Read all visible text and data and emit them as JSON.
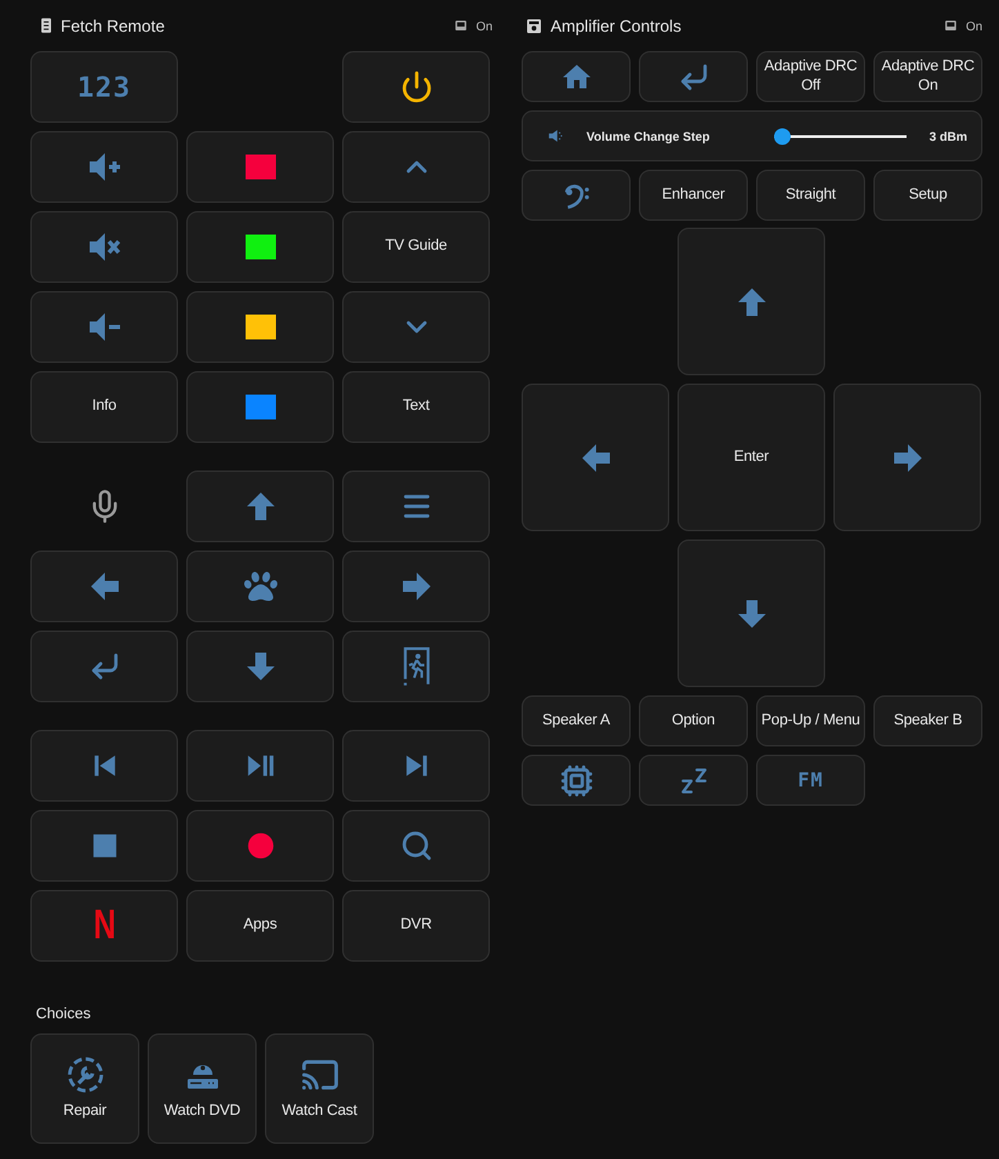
{
  "remote": {
    "title": "Fetch Remote",
    "status": "On",
    "sections": [
      {
        "buttons": [
          {
            "kind": "digital",
            "label": "123"
          },
          {
            "kind": "empty"
          },
          {
            "kind": "icon"
          },
          {
            "kind": "icon"
          },
          {
            "kind": "swatch",
            "color": "#f5003d"
          },
          {
            "kind": "icon"
          },
          {
            "kind": "icon"
          },
          {
            "kind": "swatch",
            "color": "#10f010"
          },
          {
            "kind": "label",
            "label": "TV Guide"
          },
          {
            "kind": "icon"
          },
          {
            "kind": "swatch",
            "color": "#ffc107"
          },
          {
            "kind": "icon"
          },
          {
            "kind": "label",
            "label": "Info"
          },
          {
            "kind": "swatch",
            "color": "#0a84ff"
          },
          {
            "kind": "label",
            "label": "Text"
          }
        ]
      },
      {
        "buttons": [
          {
            "kind": "bare-icon"
          },
          {
            "kind": "icon"
          },
          {
            "kind": "icon"
          },
          {
            "kind": "icon"
          },
          {
            "kind": "icon"
          },
          {
            "kind": "icon"
          },
          {
            "kind": "icon"
          },
          {
            "kind": "icon"
          },
          {
            "kind": "icon"
          }
        ]
      },
      {
        "buttons": [
          {
            "kind": "icon"
          },
          {
            "kind": "icon"
          },
          {
            "kind": "icon"
          },
          {
            "kind": "icon"
          },
          {
            "kind": "icon"
          },
          {
            "kind": "icon"
          },
          {
            "kind": "logo",
            "label": "N"
          },
          {
            "kind": "label",
            "label": "Apps"
          },
          {
            "kind": "label",
            "label": "DVR"
          }
        ]
      }
    ]
  },
  "choices": {
    "title": "Choices",
    "buttons": [
      {
        "label": "Repair"
      },
      {
        "label": "Watch DVD"
      },
      {
        "label": "Watch Cast"
      }
    ]
  },
  "amplifier": {
    "title": "Amplifier Controls",
    "status": "On",
    "top_buttons": [
      {
        "kind": "icon"
      },
      {
        "kind": "icon"
      },
      {
        "kind": "label",
        "label": "Adaptive DRC Off"
      },
      {
        "kind": "label",
        "label": "Adaptive DRC On"
      }
    ],
    "volume_step": {
      "label": "Volume Change Step",
      "level": 0,
      "reading": "3 dBm"
    },
    "mode_buttons": [
      {
        "kind": "icon"
      },
      {
        "kind": "label",
        "label": "Enhancer"
      },
      {
        "kind": "label",
        "label": "Straight"
      },
      {
        "kind": "label",
        "label": "Setup"
      }
    ],
    "dpad": [
      {
        "kind": "empty"
      },
      {
        "kind": "icon"
      },
      {
        "kind": "empty"
      },
      {
        "kind": "icon"
      },
      {
        "kind": "label",
        "label": "Enter"
      },
      {
        "kind": "icon"
      },
      {
        "kind": "empty"
      },
      {
        "kind": "icon"
      },
      {
        "kind": "empty"
      }
    ],
    "bottom_buttons": [
      {
        "kind": "label",
        "label": "Speaker A"
      },
      {
        "kind": "label",
        "label": "Option"
      },
      {
        "kind": "label",
        "label": "Pop-Up / Menu"
      },
      {
        "kind": "label",
        "label": "Speaker B"
      },
      {
        "kind": "icon"
      },
      {
        "kind": "icon"
      },
      {
        "kind": "digital",
        "label": "FM"
      }
    ]
  }
}
